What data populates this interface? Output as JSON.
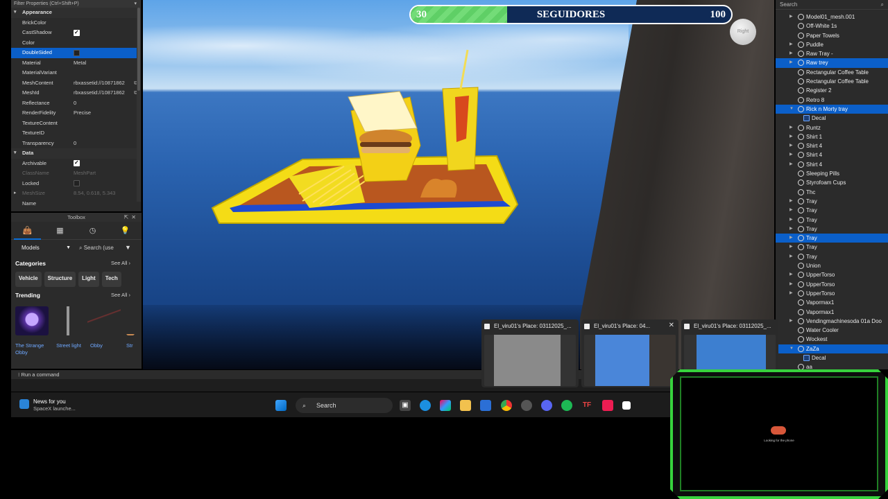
{
  "properties": {
    "filter_placeholder": "Filter Properties (Ctrl+Shift+P)",
    "rows": [
      {
        "type": "section",
        "name": "Appearance"
      },
      {
        "name": "BrickColor",
        "value": ""
      },
      {
        "name": "CastShadow",
        "check": true
      },
      {
        "name": "Color",
        "value": ""
      },
      {
        "name": "DoubleSided",
        "check": false,
        "selected": true
      },
      {
        "name": "Material",
        "value": "Metal"
      },
      {
        "name": "MaterialVariant",
        "value": ""
      },
      {
        "name": "MeshContent",
        "value": "rbxassetid://10871862",
        "lock": true
      },
      {
        "name": "MeshId",
        "value": "rbxassetid://10871862",
        "lock": true
      },
      {
        "name": "Reflectance",
        "value": "0"
      },
      {
        "name": "RenderFidelity",
        "value": "Precise"
      },
      {
        "name": "TextureContent",
        "value": ""
      },
      {
        "name": "TextureID",
        "value": ""
      },
      {
        "name": "Transparency",
        "value": "0"
      },
      {
        "type": "section",
        "name": "Data"
      },
      {
        "name": "Archivable",
        "check": true
      },
      {
        "name": "ClassName",
        "value": "MeshPart",
        "dim": true
      },
      {
        "name": "Locked",
        "check": false
      },
      {
        "name": "MeshSize",
        "value": "8.54, 0.618, 5.343",
        "dim": true,
        "expander": true
      },
      {
        "name": "Name",
        "value": ""
      }
    ]
  },
  "toolbox": {
    "title": "Toolbox",
    "dropdown": "Models",
    "search_placeholder": "Search (use",
    "categories_heading": "Categories",
    "see_all": "See All",
    "categories": [
      "Vehicle",
      "Structure",
      "Light",
      "Tech"
    ],
    "trending_heading": "Trending",
    "trending": [
      "The Strange Obby",
      "Street light",
      "Obby"
    ],
    "trending_cut": "Str"
  },
  "command_bar": {
    "placeholder": "Run a command"
  },
  "followers": {
    "min": "30",
    "label": "SEGUIDORES",
    "max": "100",
    "progress": 0.3
  },
  "view_cube": {
    "label": "Right"
  },
  "explorer": {
    "search_placeholder": "Search",
    "items": [
      {
        "name": "Model01_mesh.001",
        "exp": true
      },
      {
        "name": "Off-White 1s"
      },
      {
        "name": "Paper Towels"
      },
      {
        "name": "Puddle",
        "exp": true
      },
      {
        "name": "Raw Tray -",
        "exp": true
      },
      {
        "name": "Raw trey",
        "exp": true,
        "selected": true
      },
      {
        "name": "Rectangular Coffee Table"
      },
      {
        "name": "Rectangular Coffee Table"
      },
      {
        "name": "Register 2"
      },
      {
        "name": "Retro 8"
      },
      {
        "name": "Rick n Morty tray",
        "exp": true,
        "expanded": true,
        "selected": true
      },
      {
        "name": "Decal",
        "child": true,
        "decal": true
      },
      {
        "name": "Runtz",
        "exp": true
      },
      {
        "name": "Shirt 1",
        "exp": true
      },
      {
        "name": "Shirt 4",
        "exp": true
      },
      {
        "name": "Shirt 4",
        "exp": true
      },
      {
        "name": "Shirt 4",
        "exp": true
      },
      {
        "name": "Sleeping Pills"
      },
      {
        "name": "Styrofoam Cups"
      },
      {
        "name": "Thc"
      },
      {
        "name": "Tray",
        "exp": true
      },
      {
        "name": "Tray",
        "exp": true
      },
      {
        "name": "Tray",
        "exp": true
      },
      {
        "name": "Tray",
        "exp": true
      },
      {
        "name": "Tray",
        "exp": true,
        "selected": true
      },
      {
        "name": "Tray",
        "exp": true
      },
      {
        "name": "Tray",
        "exp": true
      },
      {
        "name": "Union"
      },
      {
        "name": "UpperTorso",
        "exp": true
      },
      {
        "name": "UpperTorso",
        "exp": true
      },
      {
        "name": "UpperTorso",
        "exp": true
      },
      {
        "name": "Vapormax1"
      },
      {
        "name": "Vapormax1"
      },
      {
        "name": "Vendingmachinesoda 01a Doo",
        "exp": true
      },
      {
        "name": "Water Cooler"
      },
      {
        "name": "Wockest"
      },
      {
        "name": "ZaZa",
        "exp": true,
        "expanded": true,
        "selected": true
      },
      {
        "name": "Decal",
        "child": true,
        "decal": true
      },
      {
        "name": "aa"
      }
    ]
  },
  "taskbar": {
    "news_title": "News for you",
    "news_sub": "SpaceX launche...",
    "search": "Search"
  },
  "previews": [
    {
      "title": "El_viru01's Place: 03112025_..."
    },
    {
      "title": "El_viru01's Place: 04..."
    },
    {
      "title": "El_viru01's Place: 03112025_..."
    }
  ],
  "overlay": {
    "loading_text": "Looking for the phone"
  }
}
